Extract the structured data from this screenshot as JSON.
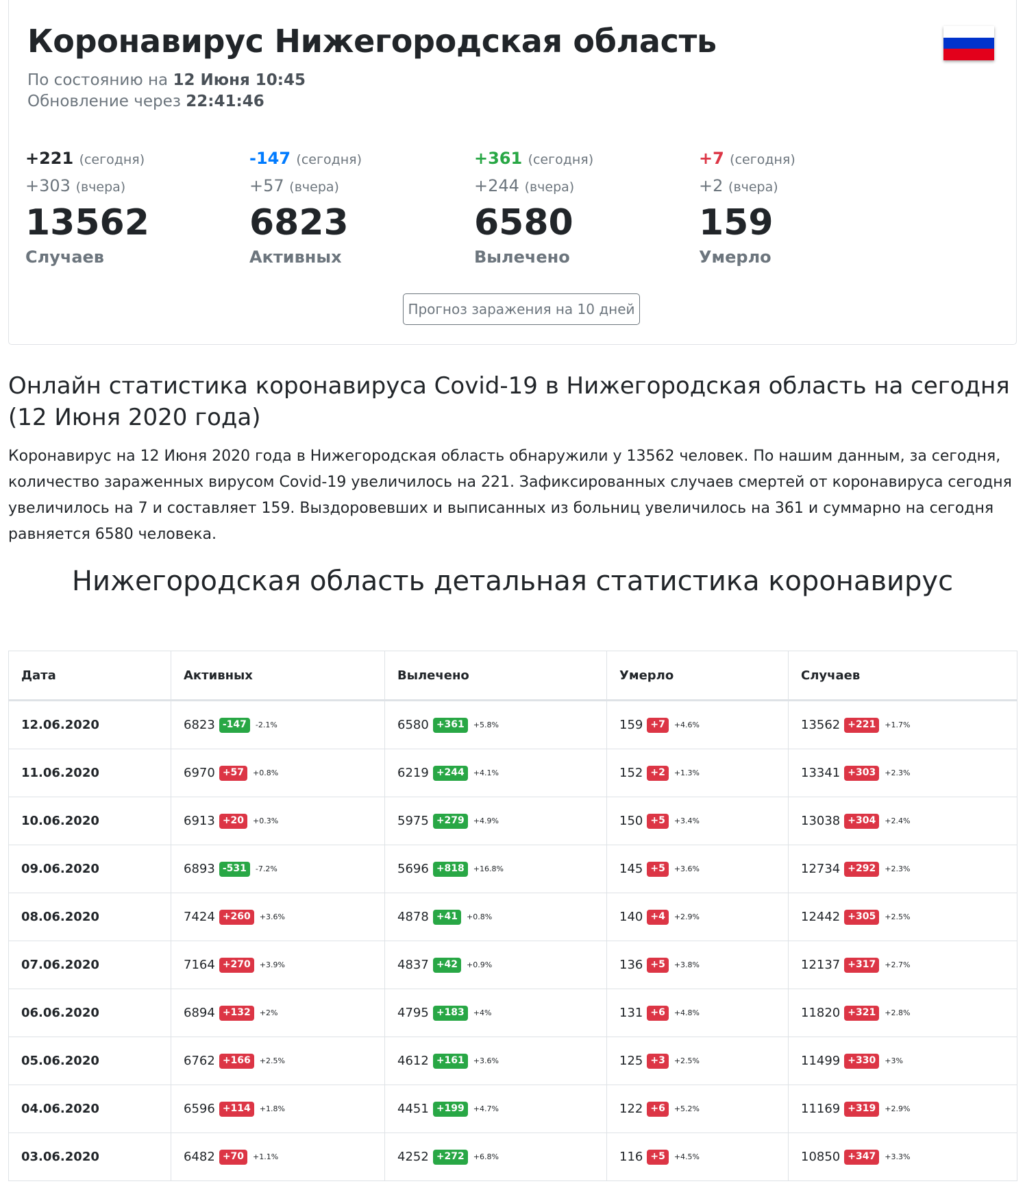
{
  "header": {
    "title": "Коронавирус Нижегородская область",
    "as_of_prefix": "По состоянию на",
    "as_of_value": "12 Июня 10:45",
    "update_prefix": "Обновление через",
    "update_value": "22:41:46"
  },
  "stats": [
    {
      "today": "+221",
      "today_note": "(сегодня)",
      "yesterday": "+303",
      "yesterday_note": "(вчера)",
      "total": "13562",
      "label": "Случаев",
      "color": "#212529"
    },
    {
      "today": "-147",
      "today_note": "(сегодня)",
      "yesterday": "+57",
      "yesterday_note": "(вчера)",
      "total": "6823",
      "label": "Активных",
      "color": "#007bff"
    },
    {
      "today": "+361",
      "today_note": "(сегодня)",
      "yesterday": "+244",
      "yesterday_note": "(вчера)",
      "total": "6580",
      "label": "Вылечено",
      "color": "#28a745"
    },
    {
      "today": "+7",
      "today_note": "(сегодня)",
      "yesterday": "+2",
      "yesterday_note": "(вчера)",
      "total": "159",
      "label": "Умерло",
      "color": "#dc3545"
    }
  ],
  "forecast_button": "Прогноз заражения на 10 дней",
  "section": {
    "heading": "Онлайн статистика коронавируса Covid-19 в Нижегородская область на сегодня (12 Июня 2020 года)",
    "paragraph": "Коронавирус на 12 Июня 2020 года в Нижегородская область обнаружили у 13562 человек. По нашим данным, за сегодня, количество зараженных вирусом Covid-19 увеличилось на 221. Зафиксированных случаев смертей от коронавируса сегодня увеличилось на 7 и составляет 159. Выздоровевших и выписанных из больниц увеличилось на 361 и суммарно на сегодня равняется 6580 человека.",
    "detail_heading": "Нижегородская область детальная статистика коронавирус"
  },
  "colors": {
    "red": "#dc3545",
    "green": "#28a745",
    "blue": "#007bff",
    "muted": "#6c757d"
  },
  "table": {
    "columns": [
      "Дата",
      "Активных",
      "Вылечено",
      "Умерло",
      "Случаев"
    ],
    "rows": [
      {
        "date": "12.06.2020",
        "cells": [
          [
            "6823",
            "-147",
            "green",
            "-2.1%"
          ],
          [
            "6580",
            "+361",
            "green",
            "+5.8%"
          ],
          [
            "159",
            "+7",
            "red",
            "+4.6%"
          ],
          [
            "13562",
            "+221",
            "red",
            "+1.7%"
          ]
        ]
      },
      {
        "date": "11.06.2020",
        "cells": [
          [
            "6970",
            "+57",
            "red",
            "+0.8%"
          ],
          [
            "6219",
            "+244",
            "green",
            "+4.1%"
          ],
          [
            "152",
            "+2",
            "red",
            "+1.3%"
          ],
          [
            "13341",
            "+303",
            "red",
            "+2.3%"
          ]
        ]
      },
      {
        "date": "10.06.2020",
        "cells": [
          [
            "6913",
            "+20",
            "red",
            "+0.3%"
          ],
          [
            "5975",
            "+279",
            "green",
            "+4.9%"
          ],
          [
            "150",
            "+5",
            "red",
            "+3.4%"
          ],
          [
            "13038",
            "+304",
            "red",
            "+2.4%"
          ]
        ]
      },
      {
        "date": "09.06.2020",
        "cells": [
          [
            "6893",
            "-531",
            "green",
            "-7.2%"
          ],
          [
            "5696",
            "+818",
            "green",
            "+16.8%"
          ],
          [
            "145",
            "+5",
            "red",
            "+3.6%"
          ],
          [
            "12734",
            "+292",
            "red",
            "+2.3%"
          ]
        ]
      },
      {
        "date": "08.06.2020",
        "cells": [
          [
            "7424",
            "+260",
            "red",
            "+3.6%"
          ],
          [
            "4878",
            "+41",
            "green",
            "+0.8%"
          ],
          [
            "140",
            "+4",
            "red",
            "+2.9%"
          ],
          [
            "12442",
            "+305",
            "red",
            "+2.5%"
          ]
        ]
      },
      {
        "date": "07.06.2020",
        "cells": [
          [
            "7164",
            "+270",
            "red",
            "+3.9%"
          ],
          [
            "4837",
            "+42",
            "green",
            "+0.9%"
          ],
          [
            "136",
            "+5",
            "red",
            "+3.8%"
          ],
          [
            "12137",
            "+317",
            "red",
            "+2.7%"
          ]
        ]
      },
      {
        "date": "06.06.2020",
        "cells": [
          [
            "6894",
            "+132",
            "red",
            "+2%"
          ],
          [
            "4795",
            "+183",
            "green",
            "+4%"
          ],
          [
            "131",
            "+6",
            "red",
            "+4.8%"
          ],
          [
            "11820",
            "+321",
            "red",
            "+2.8%"
          ]
        ]
      },
      {
        "date": "05.06.2020",
        "cells": [
          [
            "6762",
            "+166",
            "red",
            "+2.5%"
          ],
          [
            "4612",
            "+161",
            "green",
            "+3.6%"
          ],
          [
            "125",
            "+3",
            "red",
            "+2.5%"
          ],
          [
            "11499",
            "+330",
            "red",
            "+3%"
          ]
        ]
      },
      {
        "date": "04.06.2020",
        "cells": [
          [
            "6596",
            "+114",
            "red",
            "+1.8%"
          ],
          [
            "4451",
            "+199",
            "green",
            "+4.7%"
          ],
          [
            "122",
            "+6",
            "red",
            "+5.2%"
          ],
          [
            "11169",
            "+319",
            "red",
            "+2.9%"
          ]
        ]
      },
      {
        "date": "03.06.2020",
        "cells": [
          [
            "6482",
            "+70",
            "red",
            "+1.1%"
          ],
          [
            "4252",
            "+272",
            "green",
            "+6.8%"
          ],
          [
            "116",
            "+5",
            "red",
            "+4.5%"
          ],
          [
            "10850",
            "+347",
            "red",
            "+3.3%"
          ]
        ]
      }
    ]
  }
}
